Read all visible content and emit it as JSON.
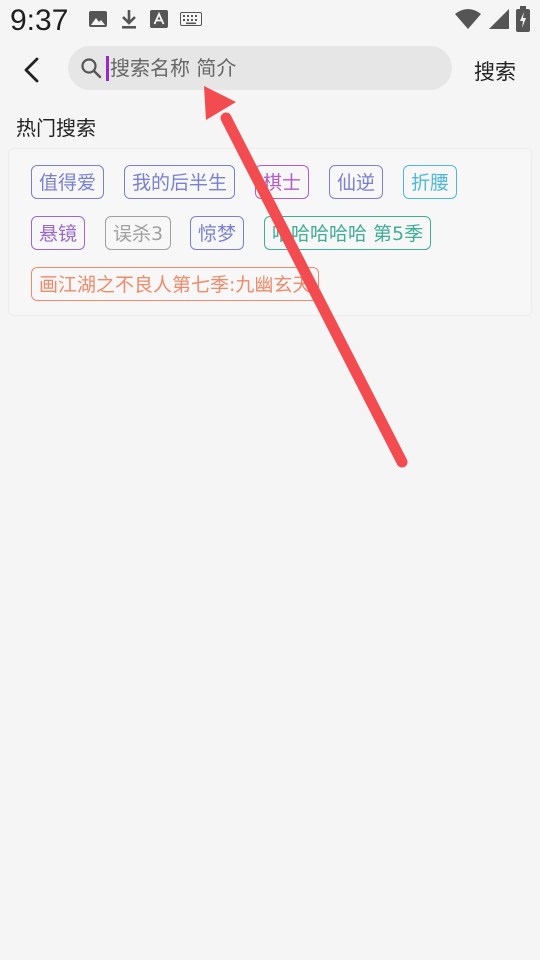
{
  "status_bar": {
    "time": "9:37",
    "left_icons": [
      "image-icon",
      "download-icon",
      "font-icon",
      "keyboard-icon"
    ],
    "right_icons": [
      "wifi-icon",
      "signal-icon",
      "battery-icon"
    ]
  },
  "header": {
    "back_icon": "chevron-left-icon",
    "search_placeholder": "搜索名称 简介",
    "search_button_label": "搜索"
  },
  "hot_search": {
    "title": "热门搜索",
    "tags": [
      {
        "label": "值得爱",
        "color": "#7a7fd0"
      },
      {
        "label": "我的后半生",
        "color": "#7a7fd0"
      },
      {
        "label": "棋士",
        "color": "#b35cc9"
      },
      {
        "label": "仙逆",
        "color": "#7a7fd0"
      },
      {
        "label": "折腰",
        "color": "#4fb8d8"
      },
      {
        "label": "悬镜",
        "color": "#9a68cf"
      },
      {
        "label": "误杀3",
        "color": "#a0a0a0"
      },
      {
        "label": "惊梦",
        "color": "#7a7fd0"
      },
      {
        "label": "哈哈哈哈哈 第5季",
        "color": "#3fad97"
      },
      {
        "label": "画江湖之不良人第七季:九幽玄天",
        "color": "#ef8a6a"
      }
    ]
  },
  "annotation": {
    "arrow_color": "#f24b50"
  }
}
